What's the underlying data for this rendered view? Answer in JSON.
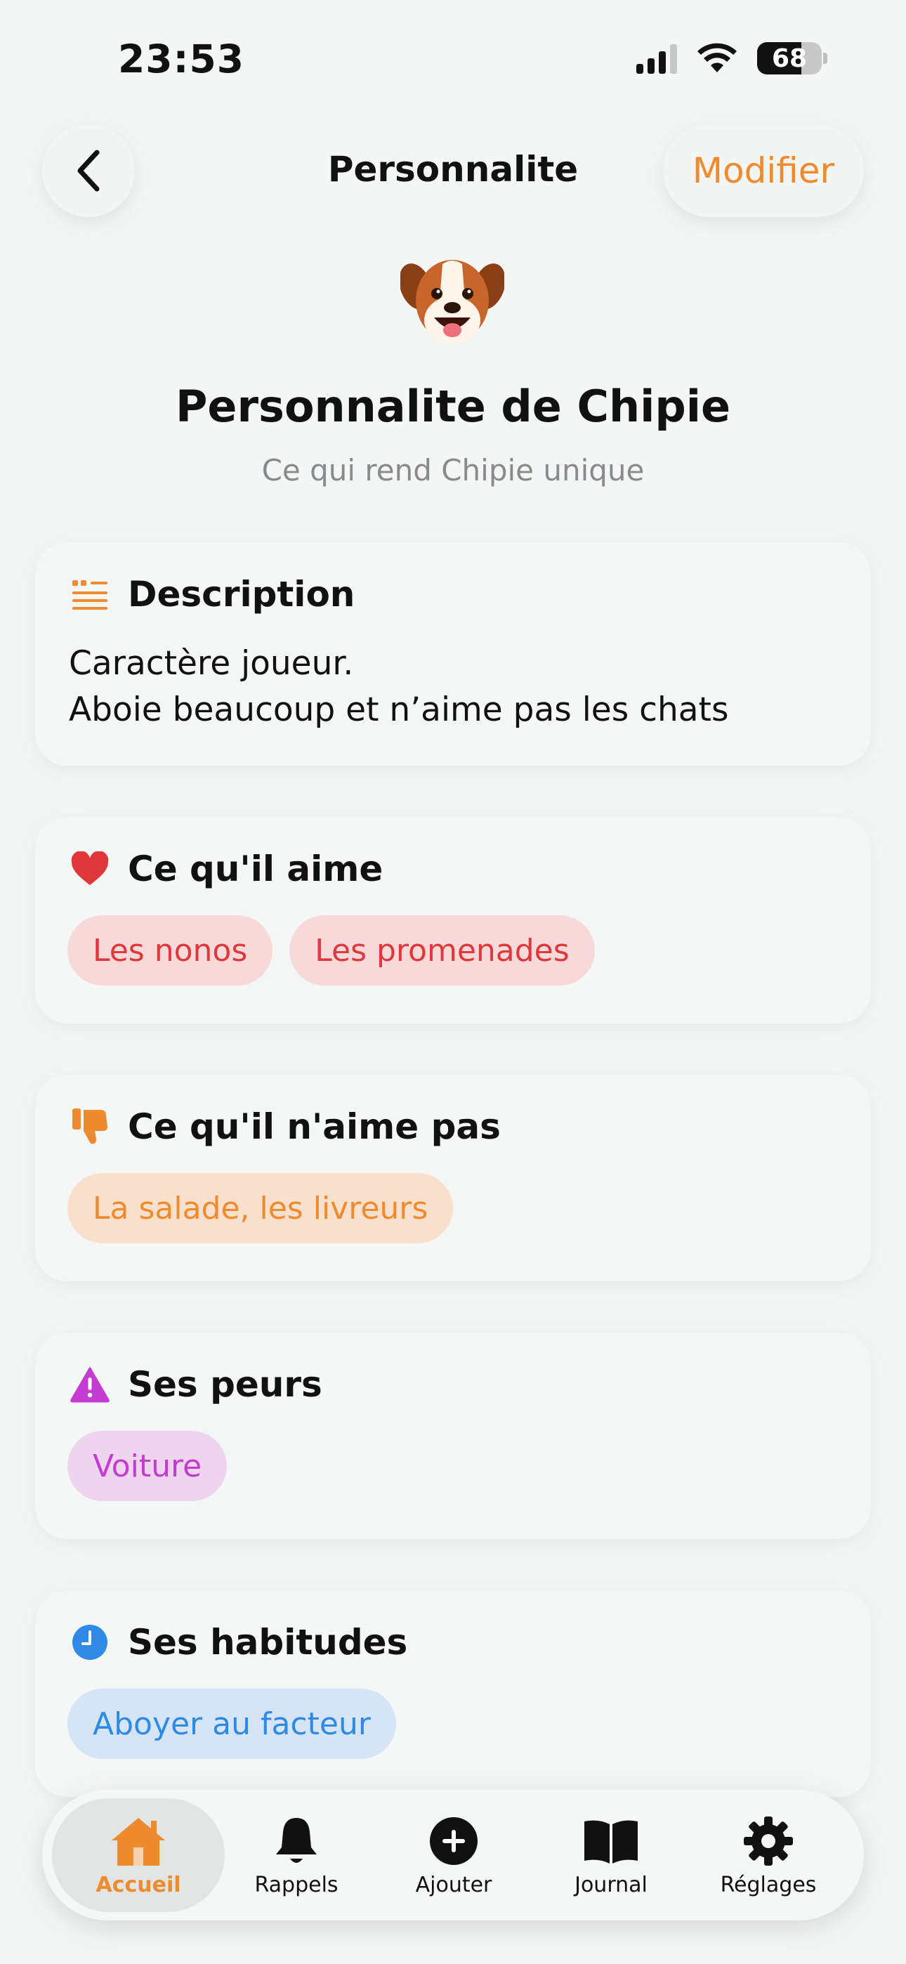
{
  "status_bar": {
    "time": "23:53",
    "battery": "68"
  },
  "nav": {
    "title": "Personnalite",
    "edit_label": "Modifier"
  },
  "header": {
    "avatar_icon": "dog-face-icon",
    "title": "Personnalite de Chipie",
    "subtitle": "Ce qui rend Chipie unique"
  },
  "description": {
    "title": "Description",
    "icon": "text-quote-icon",
    "lines": [
      "Caractère joueur.",
      "Aboie beaucoup et n’aime pas les chats"
    ]
  },
  "likes": {
    "title": "Ce qu'il aime",
    "icon": "heart-icon",
    "color": "#e0383a",
    "chips": [
      "Les nonos",
      "Les promenades"
    ]
  },
  "dislikes": {
    "title": "Ce qu'il n'aime pas",
    "icon": "thumbs-down-icon",
    "color": "#ee8b2e",
    "chips": [
      "La salade, les livreurs"
    ]
  },
  "fears": {
    "title": "Ses peurs",
    "icon": "warning-icon",
    "color": "#c43bd1",
    "chips": [
      "Voiture"
    ]
  },
  "habits": {
    "title": "Ses habitudes",
    "icon": "clock-icon",
    "color": "#2f8ae5",
    "chips": [
      "Aboyer au facteur"
    ]
  },
  "tabbar": {
    "accent": "#ee8b2e",
    "items": [
      {
        "label": "Accueil",
        "icon": "house-icon",
        "active": true
      },
      {
        "label": "Rappels",
        "icon": "bell-icon",
        "active": false
      },
      {
        "label": "Ajouter",
        "icon": "plus-circle-icon",
        "active": false
      },
      {
        "label": "Journal",
        "icon": "book-icon",
        "active": false
      },
      {
        "label": "Réglages",
        "icon": "gear-icon",
        "active": false
      }
    ]
  }
}
